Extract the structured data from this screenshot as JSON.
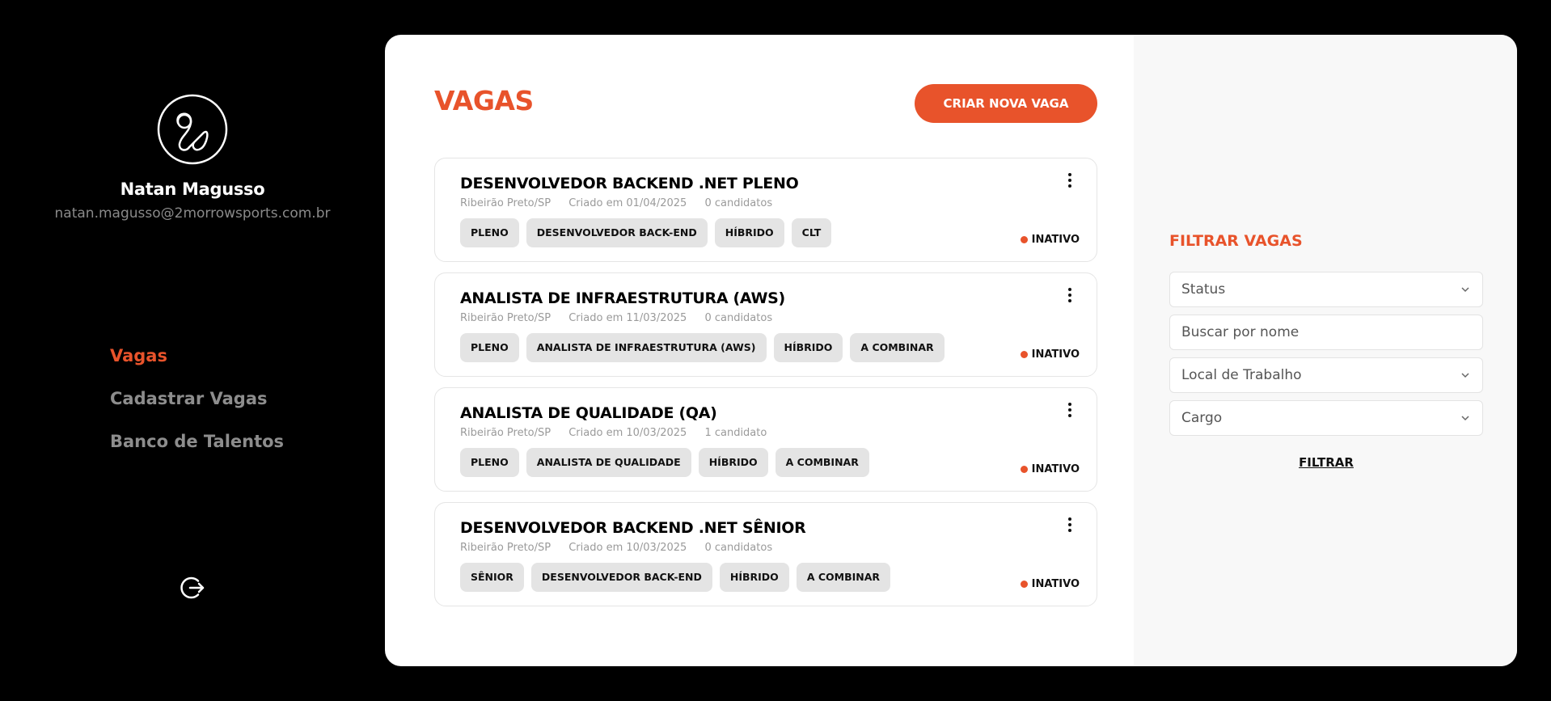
{
  "user": {
    "name": "Natan Magusso",
    "email": "natan.magusso@2morrowsports.com.br"
  },
  "nav": {
    "items": [
      {
        "label": "Vagas",
        "active": true
      },
      {
        "label": "Cadastrar Vagas",
        "active": false
      },
      {
        "label": "Banco de Talentos",
        "active": false
      }
    ],
    "logout_icon": "logout-icon"
  },
  "main": {
    "title": "VAGAS",
    "create_button": "CRIAR NOVA VAGA",
    "jobs": [
      {
        "title": "DESENVOLVEDOR BACKEND .NET PLENO",
        "location": "Ribeirão Preto/SP",
        "created": "Criado em 01/04/2025",
        "candidates": "0 candidatos",
        "tags": [
          "PLENO",
          "DESENVOLVEDOR BACK-END",
          "HÍBRIDO",
          "CLT"
        ],
        "status": "INATIVO"
      },
      {
        "title": "ANALISTA DE INFRAESTRUTURA (AWS)",
        "location": "Ribeirão Preto/SP",
        "created": "Criado em 11/03/2025",
        "candidates": "0 candidatos",
        "tags": [
          "PLENO",
          "ANALISTA DE INFRAESTRUTURA (AWS)",
          "HÍBRIDO",
          "A COMBINAR"
        ],
        "status": "INATIVO"
      },
      {
        "title": "ANALISTA DE QUALIDADE (QA)",
        "location": "Ribeirão Preto/SP",
        "created": "Criado em 10/03/2025",
        "candidates": "1 candidato",
        "tags": [
          "PLENO",
          "ANALISTA DE QUALIDADE",
          "HÍBRIDO",
          "A COMBINAR"
        ],
        "status": "INATIVO"
      },
      {
        "title": "DESENVOLVEDOR BACKEND .NET SÊNIOR",
        "location": "Ribeirão Preto/SP",
        "created": "Criado em 10/03/2025",
        "candidates": "0 candidatos",
        "tags": [
          "SÊNIOR",
          "DESENVOLVEDOR BACK-END",
          "HÍBRIDO",
          "A COMBINAR"
        ],
        "status": "INATIVO"
      }
    ]
  },
  "filters": {
    "title": "FILTRAR VAGAS",
    "status_select": "Status",
    "search_placeholder": "Buscar por nome",
    "location_select": "Local de Trabalho",
    "role_select": "Cargo",
    "submit": "FILTRAR"
  },
  "colors": {
    "accent": "#e8532b",
    "background": "#000000",
    "panel": "#ffffff",
    "filter_panel": "#f8f8f8",
    "tag": "#e4e4e4"
  }
}
